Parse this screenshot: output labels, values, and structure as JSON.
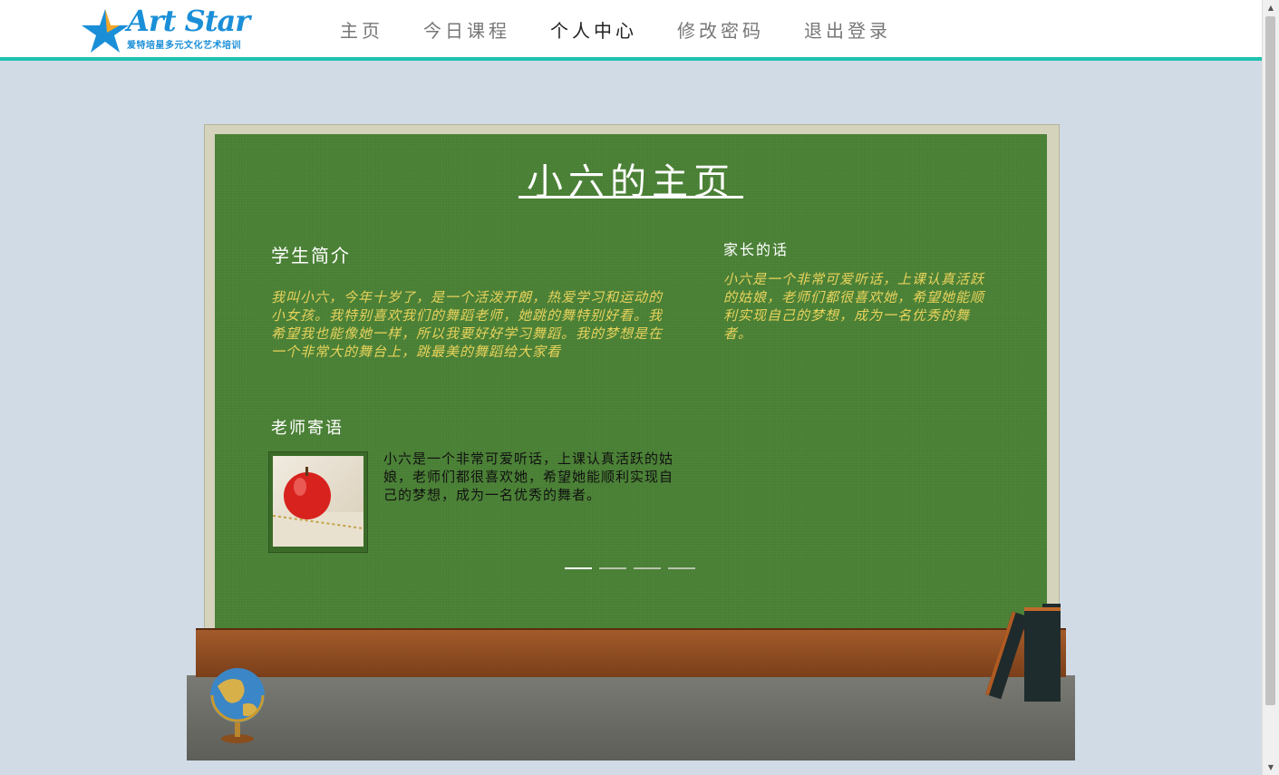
{
  "header": {
    "logo_text": "Art Star",
    "logo_subtitle": "爱特培星多元文化艺术培训",
    "nav": [
      {
        "label": "主页",
        "active": false
      },
      {
        "label": "今日课程",
        "active": false
      },
      {
        "label": "个人中心",
        "active": true
      },
      {
        "label": "修改密码",
        "active": false
      },
      {
        "label": "退出登录",
        "active": false
      }
    ]
  },
  "board": {
    "title": "小六的主页",
    "student_intro": {
      "heading": "学生简介",
      "text": "我叫小六，今年十岁了，是一个活泼开朗，热爱学习和运动的小女孩。我特别喜欢我们的舞蹈老师，她跳的舞特别好看。我希望我也能像她一样，所以我要好好学习舞蹈。我的梦想是在一个非常大的舞台上，跳最美的舞蹈给大家看"
    },
    "teacher_message": {
      "heading": "老师寄语",
      "text": "小六是一个非常可爱听话，上课认真活跃的姑娘，老师们都很喜欢她，希望她能顺利实现自己的梦想，成为一名优秀的舞者。"
    },
    "parent_message": {
      "heading": "家长的话",
      "text": "小六是一个非常可爱听话，上课认真活跃的姑娘，老师们都很喜欢她，希望她能顺利实现自己的梦想，成为一名优秀的舞者。"
    },
    "carousel": {
      "count": 4,
      "active_index": 0
    }
  },
  "colors": {
    "accent": "#1ec1b0",
    "board_green": "#497f34",
    "chalk_yellow": "#e8d35c",
    "page_bg": "#d1dbe6"
  }
}
